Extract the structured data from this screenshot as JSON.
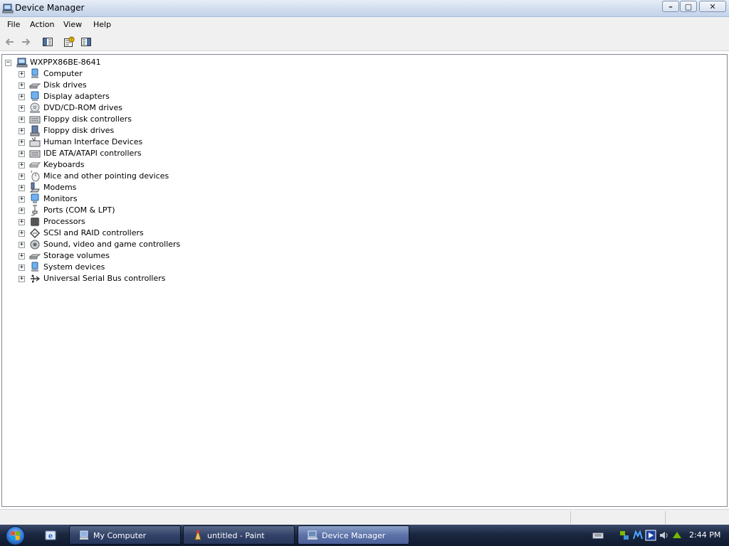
{
  "window": {
    "title": "Device Manager",
    "controls": {
      "minimize": "–",
      "maximize": "▢",
      "close": "✕"
    }
  },
  "menu": {
    "items": [
      "File",
      "Action",
      "View",
      "Help"
    ]
  },
  "toolbar": {
    "buttons": [
      "back-icon",
      "forward-icon",
      "show-hide-console-tree-icon",
      "properties-icon",
      "help-icon"
    ]
  },
  "tree": {
    "root": {
      "label": "WXPPX86BE-8641",
      "expander": "−",
      "icon": "computer-icon"
    },
    "items": [
      {
        "label": "Computer",
        "icon": "computer-icon"
      },
      {
        "label": "Disk drives",
        "icon": "disk-drive-icon"
      },
      {
        "label": "Display adapters",
        "icon": "display-adapter-icon"
      },
      {
        "label": "DVD/CD-ROM drives",
        "icon": "dvd-drive-icon"
      },
      {
        "label": "Floppy disk controllers",
        "icon": "floppy-controller-icon"
      },
      {
        "label": "Floppy disk drives",
        "icon": "floppy-drive-icon"
      },
      {
        "label": "Human Interface Devices",
        "icon": "hid-icon"
      },
      {
        "label": "IDE ATA/ATAPI controllers",
        "icon": "ide-controller-icon"
      },
      {
        "label": "Keyboards",
        "icon": "keyboard-icon"
      },
      {
        "label": "Mice and other pointing devices",
        "icon": "mouse-icon"
      },
      {
        "label": "Modems",
        "icon": "modem-icon"
      },
      {
        "label": "Monitors",
        "icon": "monitor-icon"
      },
      {
        "label": "Ports (COM & LPT)",
        "icon": "port-icon"
      },
      {
        "label": "Processors",
        "icon": "processor-icon"
      },
      {
        "label": "SCSI and RAID controllers",
        "icon": "scsi-icon"
      },
      {
        "label": "Sound, video and game controllers",
        "icon": "sound-icon"
      },
      {
        "label": "Storage volumes",
        "icon": "storage-volume-icon"
      },
      {
        "label": "System devices",
        "icon": "system-device-icon"
      },
      {
        "label": "Universal Serial Bus controllers",
        "icon": "usb-icon"
      }
    ],
    "expander_symbol": "+"
  },
  "taskbar": {
    "buttons": [
      {
        "label": "My Computer",
        "icon": "my-computer-icon",
        "active": false
      },
      {
        "label": "untitled - Paint",
        "icon": "paint-icon",
        "active": false
      },
      {
        "label": "Device Manager",
        "icon": "device-manager-icon",
        "active": true
      }
    ],
    "clock": "2:44 PM"
  },
  "colors": {
    "titlebar": "#cfdcee",
    "taskbar": "#1b2740",
    "active_task": "#5d73a8"
  }
}
